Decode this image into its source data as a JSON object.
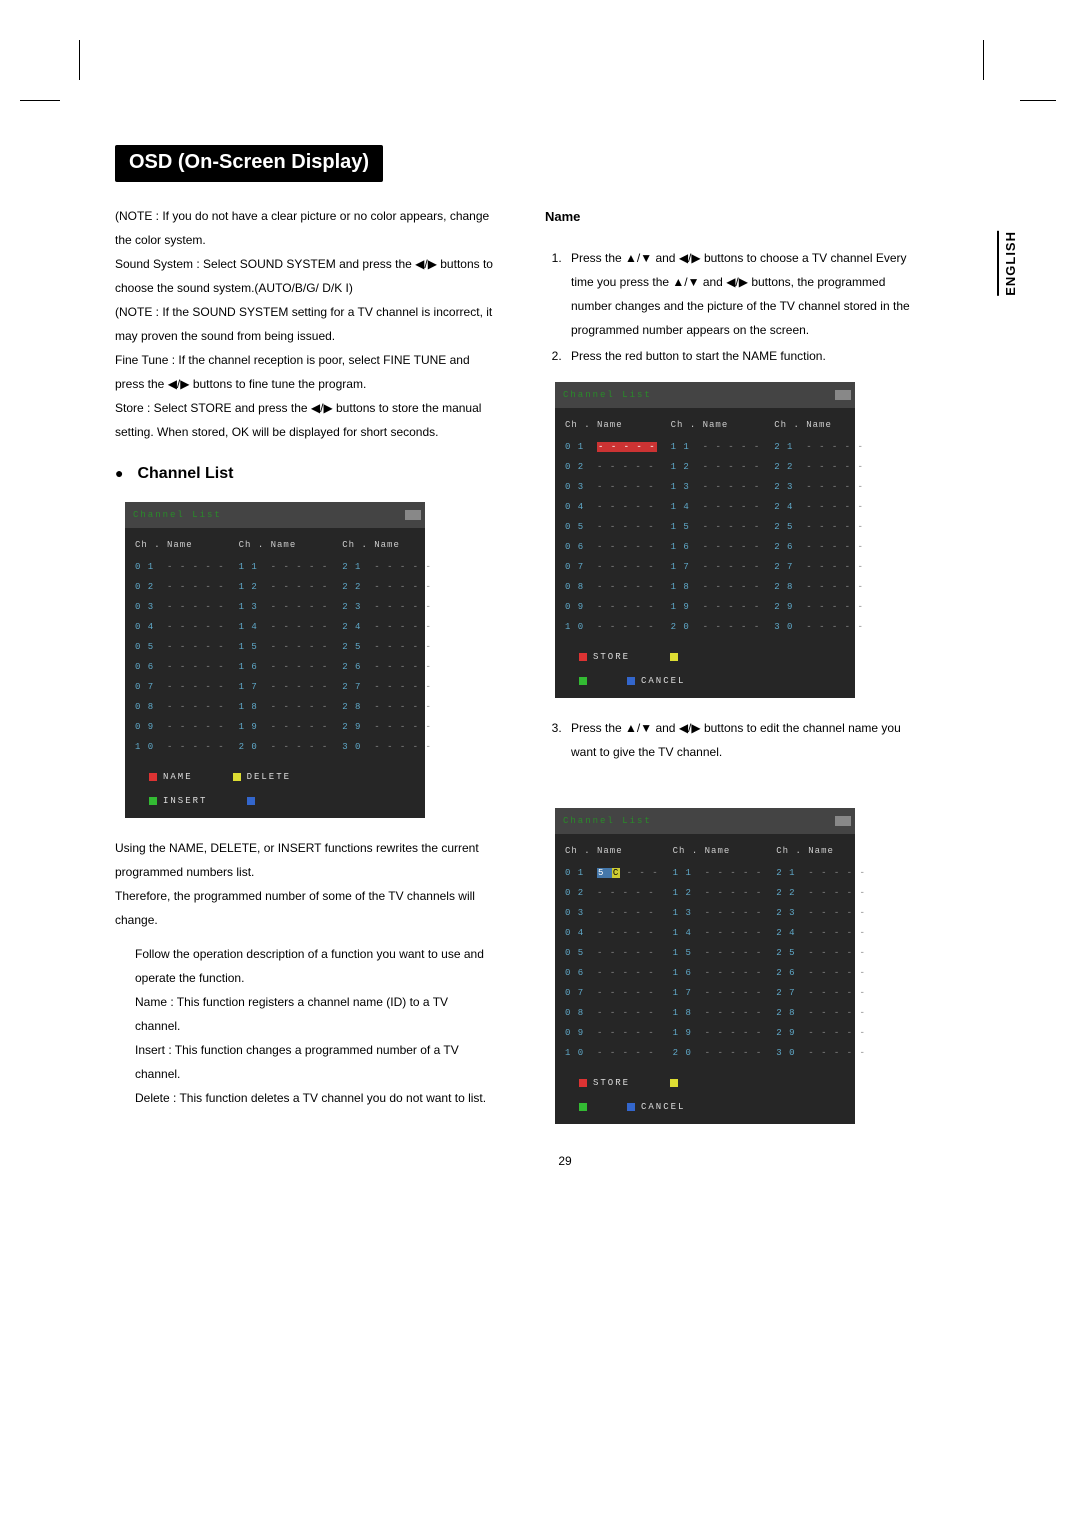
{
  "title": "OSD (On-Screen Display)",
  "language_tab": "ENGLISH",
  "page_number": "29",
  "arrows": {
    "ud": "▲/▼",
    "lr": "◀/▶"
  },
  "left": {
    "p1": "(NOTE : If you do not have a clear picture or no color appears, change the color system.",
    "p2a": "Sound System : Select SOUND SYSTEM and press the ",
    "p2b": " buttons to choose the sound system.(AUTO/B/G/ D/K I)",
    "p3": "(NOTE : If the SOUND SYSTEM setting for a TV channel is incorrect, it may proven the sound from being issued.",
    "p4a": "Fine Tune : If the channel reception is poor, select FINE TUNE and press the ",
    "p4b": " buttons to fine tune the program.",
    "p5a": "Store : Select STORE and press the ",
    "p5b": " buttons to store the manual setting. When stored, OK will be displayed for short seconds.",
    "section": "Channel List",
    "p6": "Using the NAME, DELETE, or INSERT functions rewrites the current programmed numbers list.",
    "p7": "Therefore, the programmed number of some of the TV channels will change.",
    "p8": "Follow the operation description of a function you want to use and operate the function.",
    "p9": "Name : This function registers a channel name (ID) to a TV channel.",
    "p10": "Insert : This function changes a programmed number of a TV channel.",
    "p11": "Delete : This function deletes a TV channel you do not want to list."
  },
  "right": {
    "heading": "Name",
    "s1a": "Press the ",
    "s1b": " and ",
    "s1c": " buttons to choose a TV channel Every time you press the ",
    "s1d": " and ",
    "s1e": " buttons, the programmed number changes and the picture of the TV channel stored in the",
    "s1f": "programmed number appears on the screen.",
    "s2": "Press the red button to start the NAME function.",
    "s3a": "Press the ",
    "s3b": " and ",
    "s3c": " buttons to edit the channel name you want to give the TV channel."
  },
  "osd": {
    "title": "Channel  List",
    "col_header": "Ch . Name",
    "placeholder": "- - - - -",
    "cols": {
      "a": [
        "0 1",
        "0 2",
        "0 3",
        "0 4",
        "0 5",
        "0 6",
        "0 7",
        "0 8",
        "0 9",
        "1 0"
      ],
      "b": [
        "1 1",
        "1 2",
        "1 3",
        "1 4",
        "1 5",
        "1 6",
        "1 7",
        "1 8",
        "1 9",
        "2 0"
      ],
      "c": [
        "2 1",
        "2 2",
        "2 3",
        "2 4",
        "2 5",
        "2 6",
        "2 7",
        "2 8",
        "2 9",
        "3 0"
      ]
    },
    "legend": {
      "name": "NAME",
      "delete": "DELETE",
      "insert": "INSERT",
      "store": "STORE",
      "cancel": "CANCEL"
    },
    "edit_name_value": "5 C - - -"
  }
}
